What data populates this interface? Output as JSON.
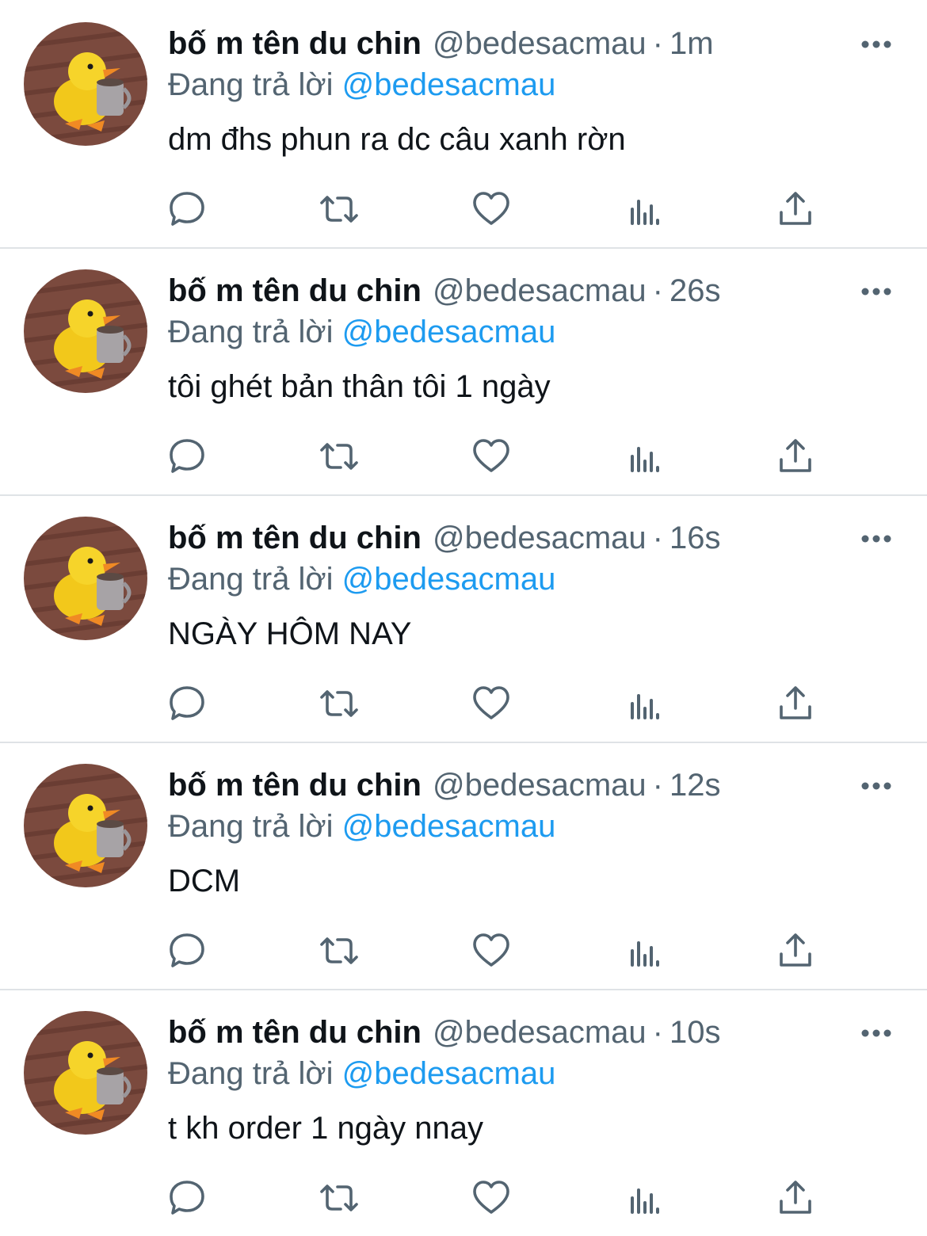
{
  "colors": {
    "text": "#0f1419",
    "secondary": "#536471",
    "link": "#1d9bf0",
    "divider": "#dfe3e6",
    "icon": "#536471"
  },
  "icons": {
    "reply": "reply-icon",
    "retweet": "retweet-icon",
    "like": "heart-icon",
    "views": "views-icon",
    "share": "share-icon",
    "more": "more-icon"
  },
  "tweets": [
    {
      "display_name": "bố m tên du chin",
      "handle": "@bedesacmau",
      "separator": "·",
      "time": "1m",
      "reply_prefix": "Đang trả lời",
      "reply_to": "@bedesacmau",
      "text": "dm đhs phun ra dc câu xanh rờn"
    },
    {
      "display_name": "bố m tên du chin",
      "handle": "@bedesacmau",
      "separator": "·",
      "time": "26s",
      "reply_prefix": "Đang trả lời",
      "reply_to": "@bedesacmau",
      "text": "tôi ghét bản thân tôi 1 ngày"
    },
    {
      "display_name": "bố m tên du chin",
      "handle": "@bedesacmau",
      "separator": "·",
      "time": "16s",
      "reply_prefix": "Đang trả lời",
      "reply_to": "@bedesacmau",
      "text": "NGÀY HÔM NAY"
    },
    {
      "display_name": "bố m tên du chin",
      "handle": "@bedesacmau",
      "separator": "·",
      "time": "12s",
      "reply_prefix": "Đang trả lời",
      "reply_to": "@bedesacmau",
      "text": "DCM"
    },
    {
      "display_name": "bố m tên du chin",
      "handle": "@bedesacmau",
      "separator": "·",
      "time": "10s",
      "reply_prefix": "Đang trả lời",
      "reply_to": "@bedesacmau",
      "text": "t kh order 1 ngày nnay"
    }
  ]
}
